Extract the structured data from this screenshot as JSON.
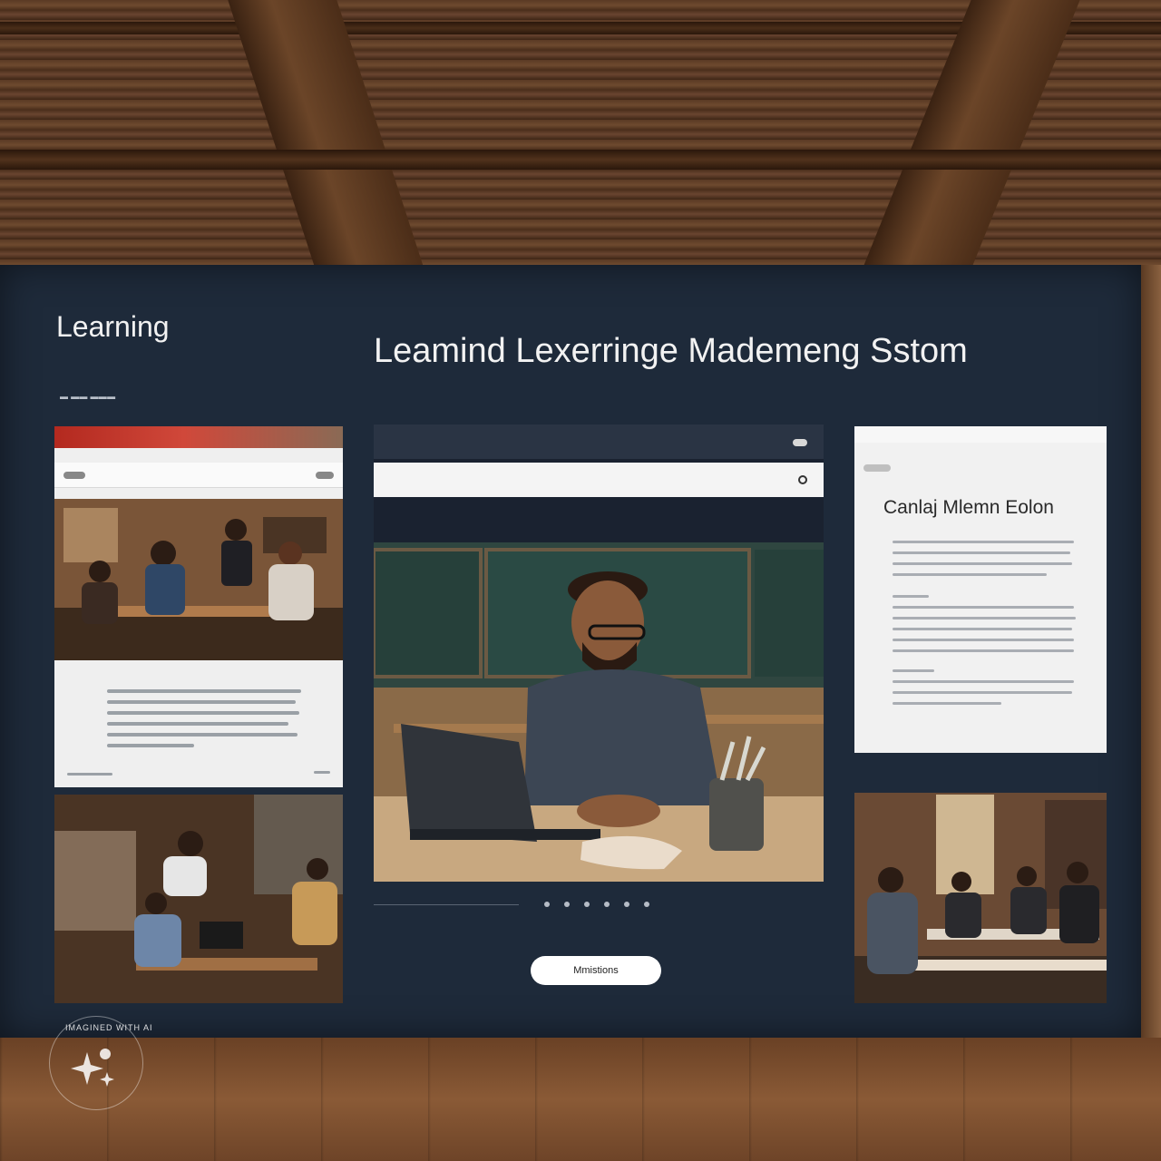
{
  "screen": {
    "brand": "Learning",
    "headline": "Leamind Lexerringe Mademeng Sstom"
  },
  "center_card": {
    "cta_label": "Mmistions"
  },
  "right_card": {
    "title": "Canlaj Mlemn Eolon"
  },
  "badge": {
    "text": "IMAGINED WITH AI"
  }
}
